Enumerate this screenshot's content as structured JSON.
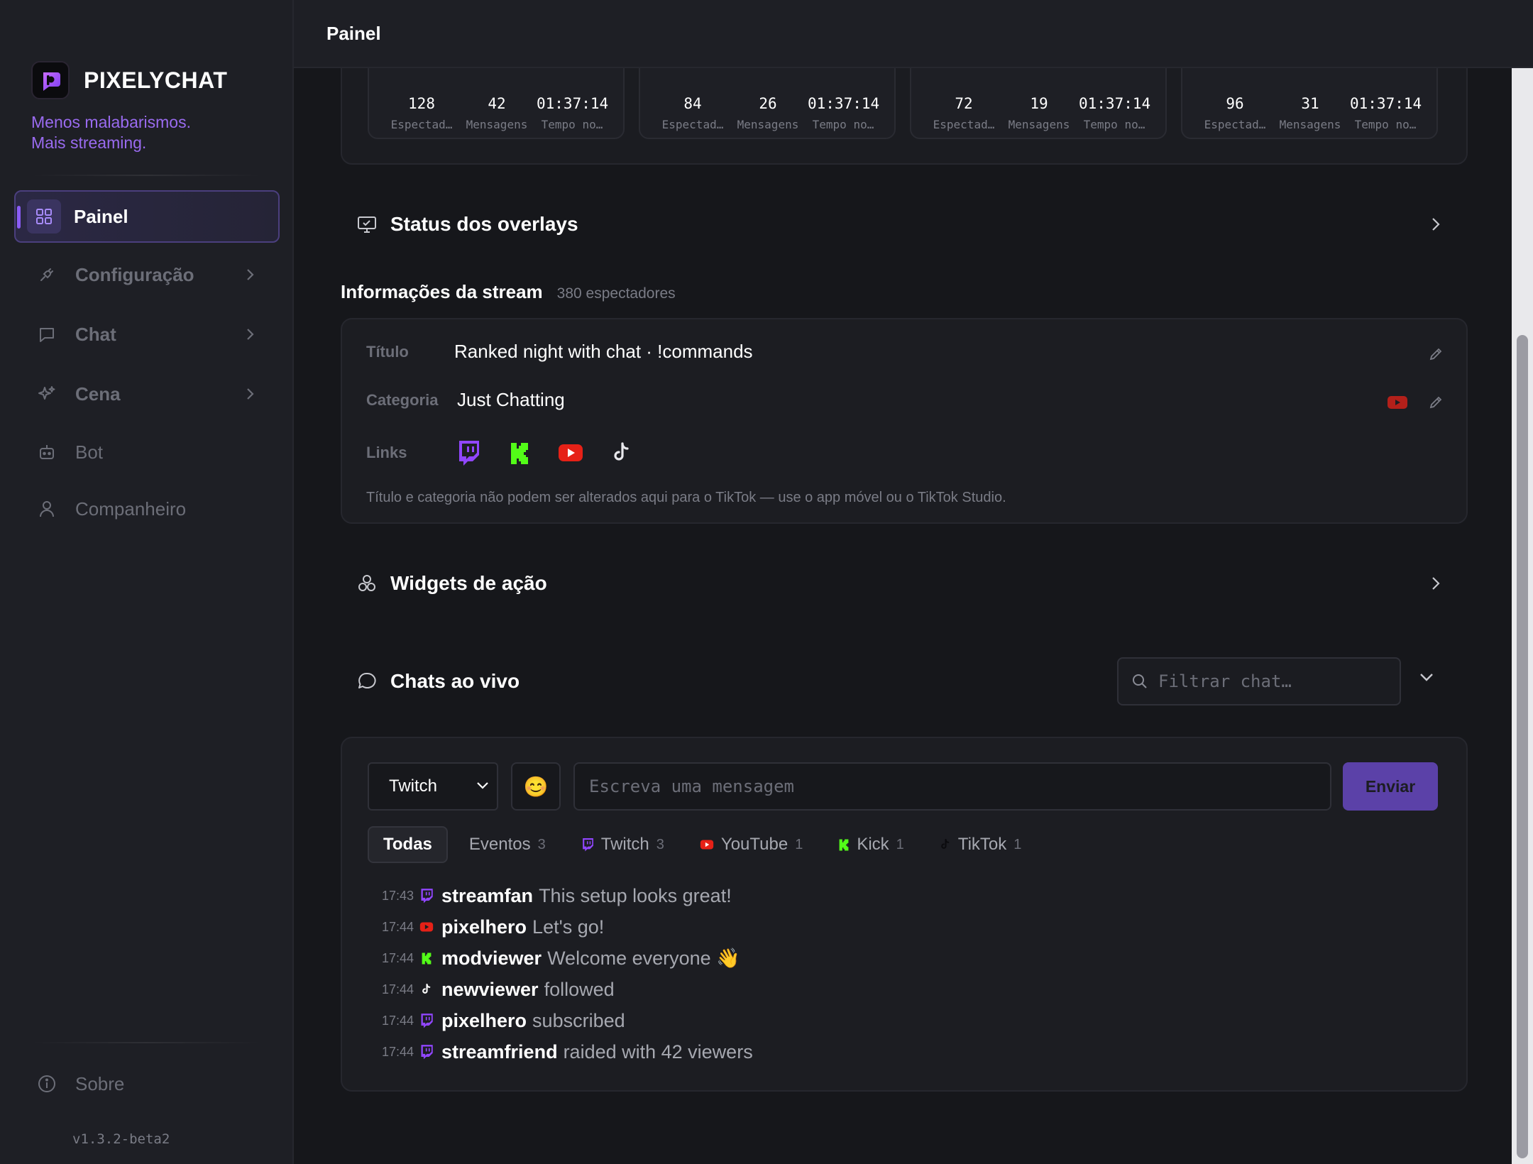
{
  "brand": {
    "name": "PIXELYCHAT",
    "tagline_1": "Menos malabarismos.",
    "tagline_2": "Mais streaming."
  },
  "nav": {
    "items": [
      {
        "label": "Painel"
      },
      {
        "label": "Configuração"
      },
      {
        "label": "Chat"
      },
      {
        "label": "Cena"
      },
      {
        "label": "Bot"
      },
      {
        "label": "Companheiro"
      }
    ],
    "about": "Sobre",
    "version": "v1.3.2-beta2"
  },
  "header": {
    "title": "Painel"
  },
  "stats": {
    "cards": [
      {
        "viewers": "128",
        "messages": "42",
        "uptime": "01:37:14"
      },
      {
        "viewers": "84",
        "messages": "26",
        "uptime": "01:37:14"
      },
      {
        "viewers": "72",
        "messages": "19",
        "uptime": "01:37:14"
      },
      {
        "viewers": "96",
        "messages": "31",
        "uptime": "01:37:14"
      }
    ],
    "label_viewers": "Espectad…",
    "label_messages": "Mensagens",
    "label_uptime": "Tempo no…"
  },
  "overlays": {
    "title": "Status dos overlays"
  },
  "stream_info": {
    "heading": "Informações da stream",
    "viewers": "380 espectadores",
    "title_key": "Título",
    "title_value": "Ranked night with chat · !commands",
    "category_key": "Categoria",
    "category_value": "Just Chatting",
    "links_key": "Links",
    "note": "Título e categoria não podem ser alterados aqui para o TikTok — use o app móvel ou o TikTok Studio."
  },
  "widgets": {
    "title": "Widgets de ação"
  },
  "live_chats": {
    "title": "Chats ao vivo",
    "filter_placeholder": "Filtrar chat…",
    "platform_select": "Twitch",
    "emoji": "😊",
    "message_placeholder": "Escreva uma mensagem",
    "send_label": "Enviar",
    "tabs": [
      {
        "label": "Todas",
        "count": ""
      },
      {
        "label": "Eventos",
        "count": "3"
      },
      {
        "label": "Twitch",
        "count": "3"
      },
      {
        "label": "YouTube",
        "count": "1"
      },
      {
        "label": "Kick",
        "count": "1"
      },
      {
        "label": "TikTok",
        "count": "1"
      }
    ],
    "messages": [
      {
        "time": "17:43",
        "platform": "twitch-icon",
        "user": "streamfan",
        "text": "This setup looks great!"
      },
      {
        "time": "17:44",
        "platform": "youtube-icon",
        "user": "pixelhero",
        "text": "Let's go!"
      },
      {
        "time": "17:44",
        "platform": "kick-icon",
        "user": "modviewer",
        "text": "Welcome everyone 👋"
      },
      {
        "time": "17:44",
        "platform": "tiktok-icon",
        "user": "newviewer",
        "text": "followed"
      },
      {
        "time": "17:44",
        "platform": "twitch-icon",
        "user": "pixelhero",
        "text": "subscribed"
      },
      {
        "time": "17:44",
        "platform": "twitch-icon",
        "user": "streamfriend",
        "text": "raided with 42 viewers"
      }
    ]
  },
  "colors": {
    "accent": "#8b5cf6",
    "twitch": "#9146ff",
    "youtube": "#e62117",
    "kick": "#53fc18",
    "tiktok": "#ffffff"
  }
}
